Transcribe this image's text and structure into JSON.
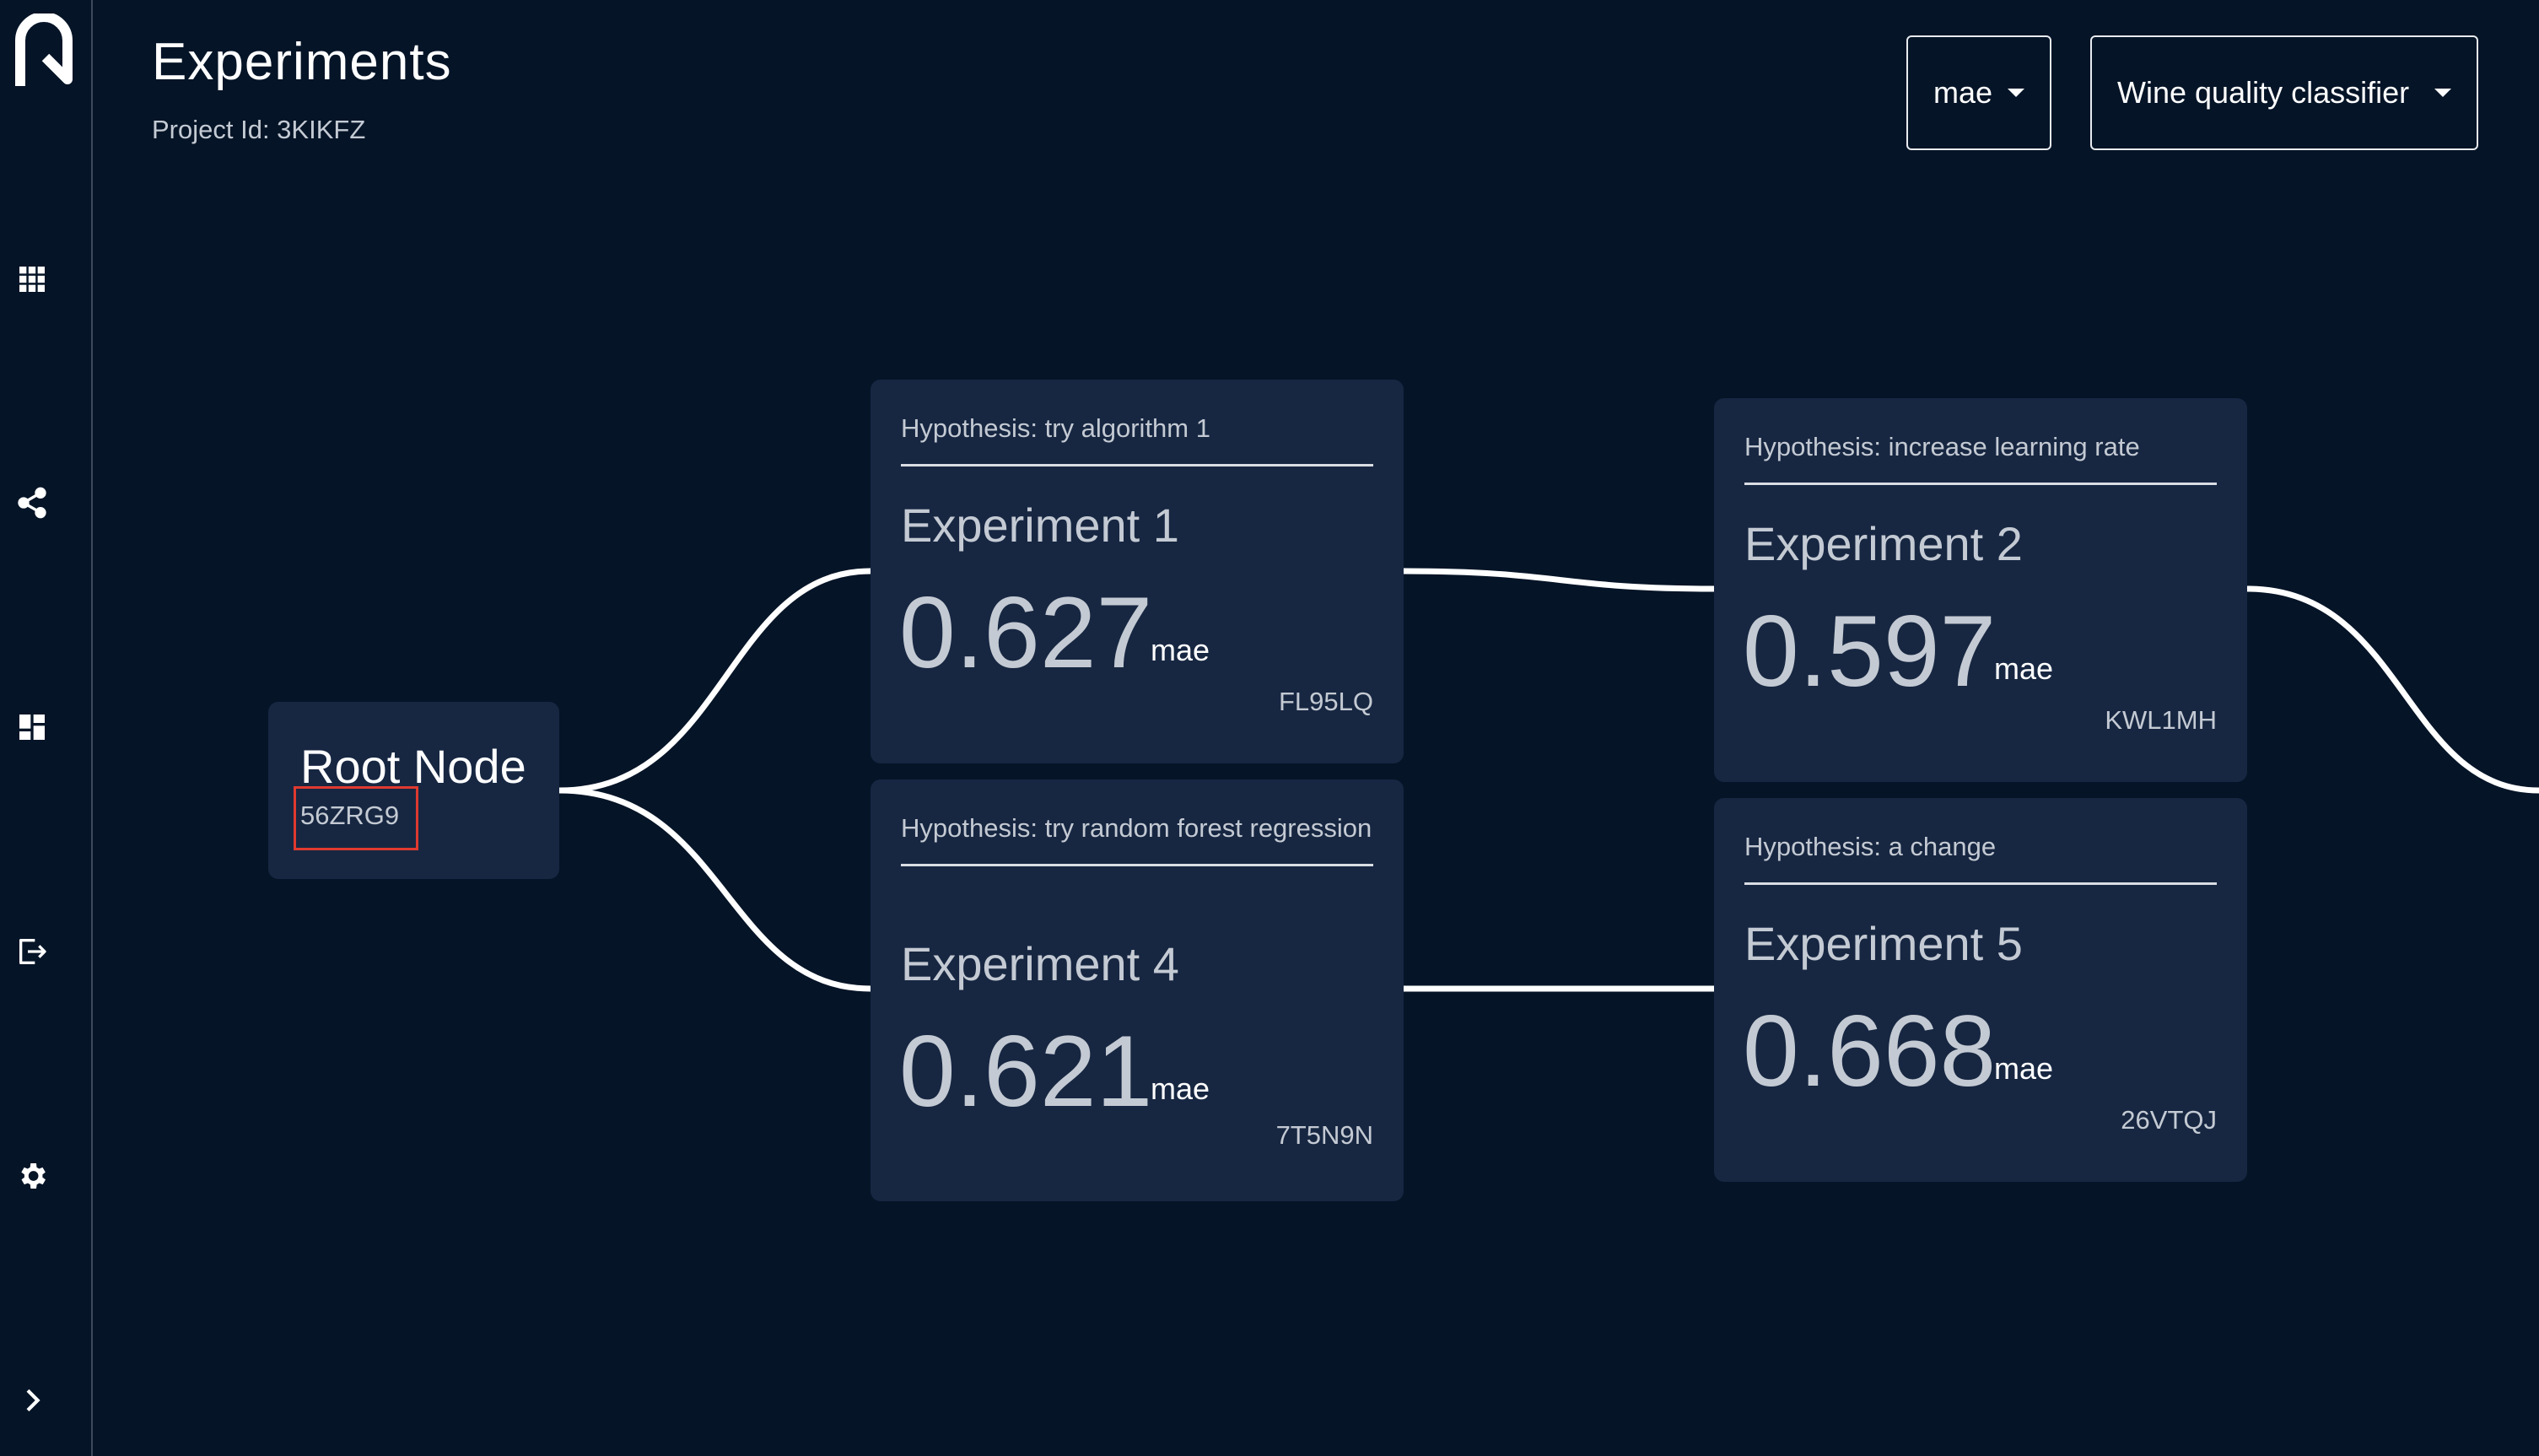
{
  "app": {
    "logo_icon": "app-logo-icon",
    "accent_color": "#e03a2f",
    "background_color": "#051427",
    "card_color": "#172742"
  },
  "sidebar": {
    "items": [
      {
        "icon": "grid-icon"
      },
      {
        "icon": "share-icon"
      },
      {
        "icon": "dashboard-icon"
      },
      {
        "icon": "logout-icon"
      },
      {
        "icon": "gear-icon"
      },
      {
        "icon": "chevron-right-icon"
      }
    ]
  },
  "header": {
    "title": "Experiments",
    "project_id": "Project Id: 3KIKFZ",
    "metric_select": {
      "value": "mae"
    },
    "project_select": {
      "value": "Wine quality classifier"
    }
  },
  "graph": {
    "root": {
      "title": "Root Node",
      "id": "56ZRG9"
    },
    "experiments": [
      {
        "hypothesis": "Hypothesis: try algorithm 1",
        "name": "Experiment 1",
        "value": "0.627",
        "unit": "mae",
        "id": "FL95LQ"
      },
      {
        "hypothesis": "Hypothesis: try random forest regression",
        "name": "Experiment 4",
        "value": "0.621",
        "unit": "mae",
        "id": "7T5N9N"
      },
      {
        "hypothesis": "Hypothesis: increase learning rate",
        "name": "Experiment 2",
        "value": "0.597",
        "unit": "mae",
        "id": "KWL1MH"
      },
      {
        "hypothesis": "Hypothesis: a change",
        "name": "Experiment 5",
        "value": "0.668",
        "unit": "mae",
        "id": "26VTQJ"
      }
    ]
  }
}
